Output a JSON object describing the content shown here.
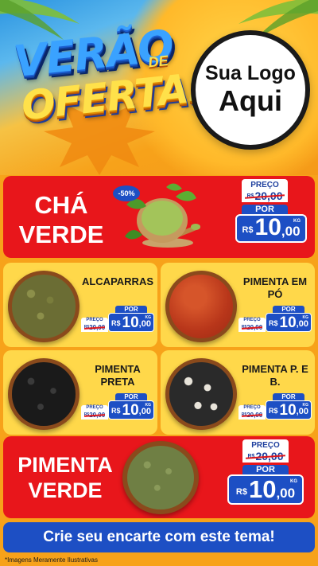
{
  "header": {
    "title_line1": "VERÃO",
    "title_de": "DE",
    "title_line2": "OFERTAS",
    "logo_line1": "Sua Logo",
    "logo_line2": "Aqui"
  },
  "labels": {
    "preco": "PREÇO",
    "por": "POR",
    "currency": "R$",
    "kg": "KG"
  },
  "featured": [
    {
      "name_line1": "CHÁ",
      "name_line2": "VERDE",
      "discount": "-50%",
      "old_price": "20,00",
      "new_int": "10",
      "new_cents": ",00"
    },
    {
      "name_line1": "PIMENTA",
      "name_line2": "VERDE",
      "old_price": "20,00",
      "new_int": "10",
      "new_cents": ",00"
    }
  ],
  "products": [
    {
      "name": "ALCAPARRAS",
      "old_price": "20,00",
      "new_int": "10",
      "new_cents": ",00"
    },
    {
      "name": "PIMENTA EM PÓ",
      "old_price": "20,00",
      "new_int": "10",
      "new_cents": ",00"
    },
    {
      "name": "PIMENTA PRETA",
      "old_price": "20,00",
      "new_int": "10",
      "new_cents": ",00"
    },
    {
      "name": "PIMENTA P. E B.",
      "old_price": "20,00",
      "new_int": "10",
      "new_cents": ",00"
    }
  ],
  "footer": {
    "cta": "Crie seu encarte com este tema!",
    "disclaimer": "*Imagens Meramente Ilustrativas"
  },
  "colors": {
    "red_panel": "#e8161b",
    "yellow_card": "#ffd84a",
    "price_blue": "#1d4fc4",
    "background_orange": "#f7a21a"
  }
}
